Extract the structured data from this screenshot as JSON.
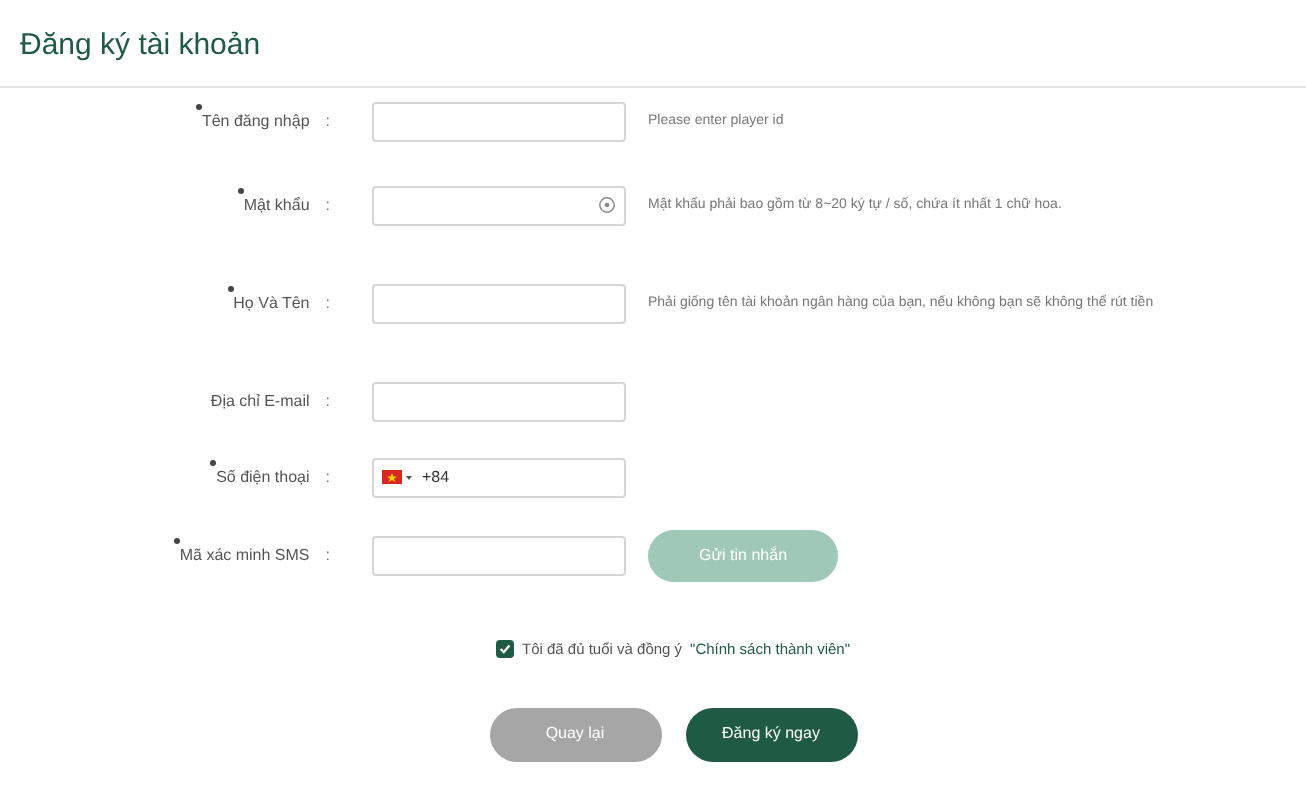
{
  "title": "Đăng ký tài khoản",
  "fields": [
    {
      "label": "Tên đăng nhập",
      "colon": ":",
      "required": true,
      "kind": "text",
      "hint": "Please enter player id"
    },
    {
      "label": "Mật khẩu",
      "colon": ":",
      "required": true,
      "kind": "password",
      "hint": "Mật khẩu phải bao gồm từ 8~20 ký tự / số, chứa ít nhất 1 chữ hoa."
    },
    {
      "label": "Họ Và Tên",
      "colon": ":",
      "required": true,
      "kind": "text",
      "hint": "Phải giống tên tài khoản ngân hàng của bạn, nếu không bạn sẽ không thể rút tiền"
    },
    {
      "label": "Địa chỉ E-mail",
      "colon": ":",
      "required": false,
      "kind": "text"
    },
    {
      "label": "Số điện thoại",
      "colon": ":",
      "required": true,
      "kind": "phone",
      "value": "+84"
    },
    {
      "label": "Mã xác minh SMS",
      "colon": ":",
      "required": true,
      "kind": "sms",
      "button": "Gửi tin nhắn"
    }
  ],
  "agreement": {
    "checked": true,
    "text": "Tôi đã đủ tuổi và đồng ý",
    "link": "\"Chính sách thành viên\""
  },
  "buttons": [
    {
      "label": "Quay lại",
      "kind": "back"
    },
    {
      "label": "Đăng ký ngay",
      "kind": "submit"
    }
  ]
}
